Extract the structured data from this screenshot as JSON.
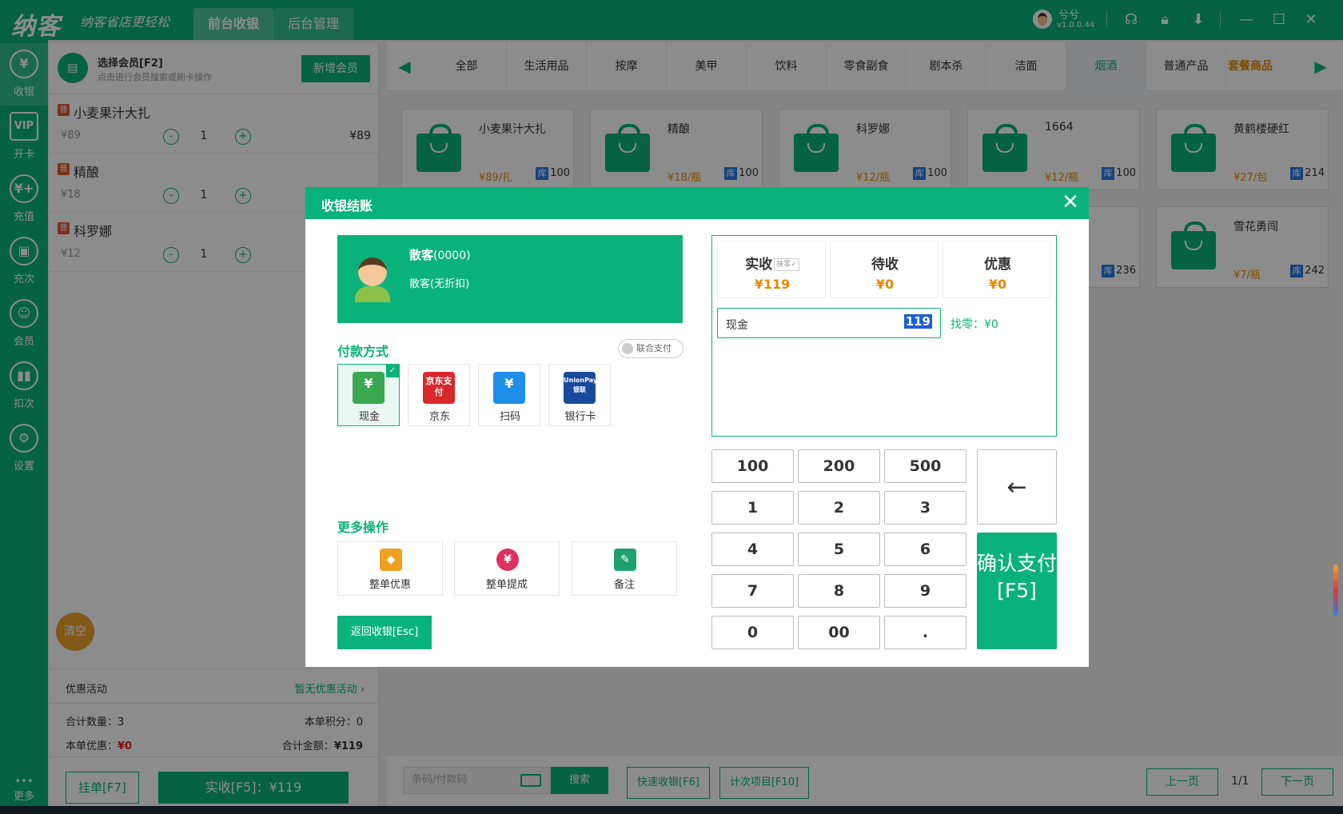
{
  "topbar": {
    "logo": "纳客",
    "slogan": "纳客省店更轻松",
    "tabs": [
      "前台收银",
      "后台管理"
    ],
    "user_name": "兮兮",
    "version": "v1.0.0.44"
  },
  "rail": [
    {
      "label": "收银",
      "icon": "cashier-icon"
    },
    {
      "label": "开卡",
      "icon": "vip-card-icon"
    },
    {
      "label": "充值",
      "icon": "recharge-icon"
    },
    {
      "label": "充次",
      "icon": "count-recharge-icon"
    },
    {
      "label": "会员",
      "icon": "member-icon"
    },
    {
      "label": "扣次",
      "icon": "deduct-icon"
    },
    {
      "label": "设置",
      "icon": "settings-icon"
    },
    {
      "label": "更多",
      "icon": "more-icon"
    }
  ],
  "cart": {
    "member_title": "选择会员[F2]",
    "member_hint": "点击进行会员搜索或刷卡操作",
    "add_member": "新增会员",
    "items": [
      {
        "tag": "普",
        "name": "小麦果汁大扎",
        "price": "¥89",
        "qty": "1",
        "subtotal": "¥89"
      },
      {
        "tag": "普",
        "name": "精酿",
        "price": "¥18",
        "qty": "1",
        "subtotal": ""
      },
      {
        "tag": "普",
        "name": "科罗娜",
        "price": "¥12",
        "qty": "1",
        "subtotal": ""
      }
    ],
    "minus": "-",
    "plus": "+",
    "clear": "清空",
    "promo_label": "优惠活动",
    "promo_value": "暂无优惠活动",
    "total_qty": "合计数量：3",
    "points": "本单积分：0",
    "discount_label": "本单优惠：",
    "discount_value": "¥0",
    "total_label": "合计金额：",
    "total_value": "¥119",
    "hold": "挂单[F7]",
    "pay": "实收[F5]：¥119"
  },
  "categories": {
    "items": [
      "全部",
      "生活用品",
      "按摩",
      "美甲",
      "饮料",
      "零食副食",
      "剧本杀",
      "洁面",
      "烟酒",
      "普通产品",
      "套餐商品"
    ],
    "active": "烟酒"
  },
  "products": [
    {
      "name": "小麦果汁大扎",
      "price": "¥89/扎",
      "stock": "100"
    },
    {
      "name": "精酿",
      "price": "¥18/瓶",
      "stock": "100"
    },
    {
      "name": "科罗娜",
      "price": "¥12/瓶",
      "stock": "100"
    },
    {
      "name": "1664",
      "price": "¥12/瓶",
      "stock": "100"
    },
    {
      "name": "黄鹤楼硬红",
      "price": "¥27/包",
      "stock": "214"
    },
    {
      "name": "",
      "price": "",
      "stock": "236"
    },
    {
      "name": "雪花勇闯",
      "price": "¥7/瓶",
      "stock": "242"
    }
  ],
  "stock_tag": "库",
  "bottom": {
    "barcode_placeholder": "条码/付款码",
    "search": "搜索",
    "quick_cash": "快速收银[F6]",
    "count_items": "计次项目[F10]",
    "prev": "上一页",
    "page": "1/1",
    "next": "下一页"
  },
  "modal": {
    "title": "收银结账",
    "close": "✕",
    "customer_name": "散客",
    "customer_id": "(0000)",
    "customer_level": "散客(无折扣)",
    "pay_method_title": "付款方式",
    "joint_pay": "联合支付",
    "methods": [
      {
        "label": "现金",
        "icon": "cash-icon",
        "glyph": "¥",
        "color": "#3aa851"
      },
      {
        "label": "京东",
        "icon": "jd-pay-icon",
        "glyph": "京东支付",
        "color": "#d8282c"
      },
      {
        "label": "扫码",
        "icon": "scan-icon",
        "glyph": "¥",
        "color": "#1e8ee8"
      },
      {
        "label": "银行卡",
        "icon": "unionpay-icon",
        "glyph": "UnionPay 银联",
        "color": "#1a4a9c"
      }
    ],
    "selected_method": "现金",
    "more_ops_title": "更多操作",
    "ops": [
      {
        "label": "整单优惠",
        "icon": "discount-tag-icon",
        "glyph": "◆",
        "color": "#f0a020"
      },
      {
        "label": "整单提成",
        "icon": "money-bag-icon",
        "glyph": "¥",
        "color": "#e03060"
      },
      {
        "label": "备注",
        "icon": "note-edit-icon",
        "glyph": "✎",
        "color": "#20a070"
      }
    ],
    "back": "返回收银[Esc]",
    "summary": {
      "received_label": "实收",
      "moling": "抹零",
      "received_value": "¥119",
      "pending_label": "待收",
      "pending_value": "¥0",
      "discount_label": "优惠",
      "discount_value": "¥0"
    },
    "cash_label": "现金",
    "cash_value": "119",
    "change": "找零：¥0",
    "keys": [
      "100",
      "200",
      "500",
      "1",
      "2",
      "3",
      "4",
      "5",
      "6",
      "7",
      "8",
      "9",
      "0",
      "00",
      "."
    ],
    "backspace": "←",
    "confirm": "确认支付[F5]"
  }
}
